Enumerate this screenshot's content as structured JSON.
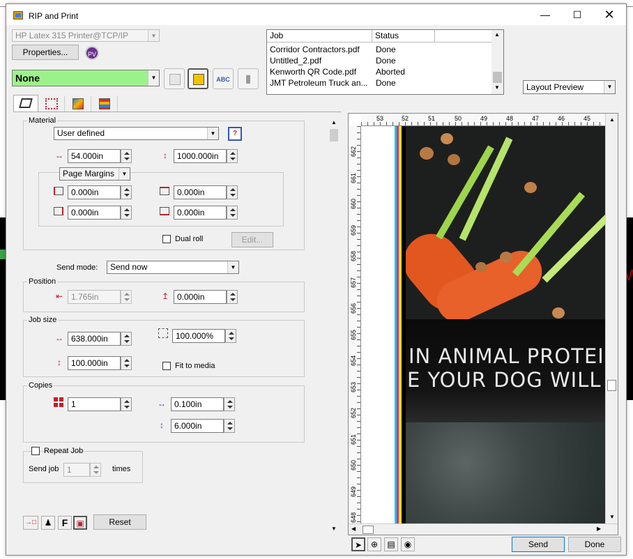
{
  "window": {
    "title": "RIP and Print"
  },
  "printer": {
    "value": "HP Latex 315 Printer@TCP/IP",
    "properties_label": "Properties..."
  },
  "preset": {
    "value": "None"
  },
  "job_list": {
    "headers": [
      "Job",
      "Status"
    ],
    "rows": [
      {
        "job": "Corridor Contractors.pdf",
        "status": "Done"
      },
      {
        "job": "Untitled_2.pdf",
        "status": "Done"
      },
      {
        "job": "Kenworth QR Code.pdf",
        "status": "Aborted"
      },
      {
        "job": "JMT Petroleum Truck an...",
        "status": "Done"
      }
    ]
  },
  "layout_preview": {
    "value": "Layout Preview"
  },
  "material": {
    "group_label": "Material",
    "type": "User defined",
    "width": "54.000in",
    "length": "1000.000in",
    "margins_mode": "Page Margins",
    "margin_left": "0.000in",
    "margin_top": "0.000in",
    "margin_right": "0.000in",
    "margin_bottom": "0.000in",
    "dual_roll_label": "Dual roll",
    "edit_label": "Edit..."
  },
  "send_mode": {
    "label": "Send mode:",
    "value": "Send now"
  },
  "position": {
    "group_label": "Position",
    "x": "1.765in",
    "y": "0.000in"
  },
  "job_size": {
    "group_label": "Job size",
    "width": "638.000in",
    "height": "100.000in",
    "scale": "100.000%",
    "fit_label": "Fit to media"
  },
  "copies": {
    "group_label": "Copies",
    "count": "1",
    "h_gap": "0.100in",
    "v_gap": "6.000in"
  },
  "repeat": {
    "label": "Repeat Job",
    "send_job_label": "Send job",
    "count": "1",
    "times_label": "times"
  },
  "bottom": {
    "reset_label": "Reset",
    "send_label": "Send",
    "done_label": "Done"
  },
  "ruler": {
    "top_ticks": [
      "53",
      "52",
      "51",
      "50",
      "49",
      "48",
      "47",
      "46",
      "45"
    ],
    "left_ticks": [
      "662",
      "661",
      "660",
      "659",
      "658",
      "657",
      "656",
      "655",
      "654",
      "653",
      "652",
      "651",
      "650",
      "649",
      "648"
    ]
  },
  "preview_image": {
    "line1": "IN ANIMAL PROTEIN FO",
    "line2": "E YOUR DOG WILL"
  }
}
